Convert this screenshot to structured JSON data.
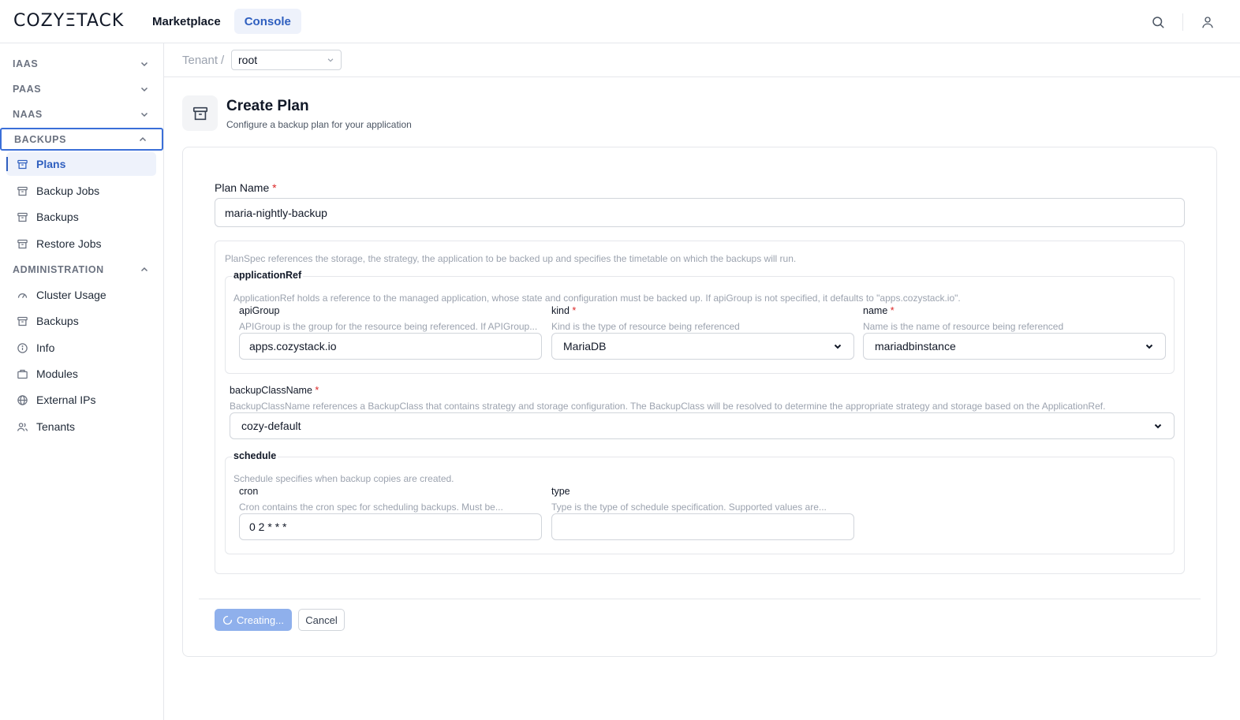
{
  "app": {
    "logo_text": "COZYΞTACK"
  },
  "topnav": {
    "items": [
      "Marketplace",
      "Console"
    ],
    "active": "Console"
  },
  "sidebar": {
    "sections": [
      {
        "label": "IAAS",
        "expanded": false
      },
      {
        "label": "PAAS",
        "expanded": false
      },
      {
        "label": "NAAS",
        "expanded": false
      },
      {
        "label": "BACKUPS",
        "expanded": true,
        "items": [
          {
            "label": "Plans",
            "icon": "archive-icon",
            "active": true
          },
          {
            "label": "Backup Jobs",
            "icon": "archive-icon"
          },
          {
            "label": "Backups",
            "icon": "archive-icon"
          },
          {
            "label": "Restore Jobs",
            "icon": "archive-icon"
          }
        ]
      },
      {
        "label": "ADMINISTRATION",
        "expanded": true,
        "items": [
          {
            "label": "Cluster Usage",
            "icon": "gauge-icon"
          },
          {
            "label": "Backups",
            "icon": "archive-icon"
          },
          {
            "label": "Info",
            "icon": "info-icon"
          },
          {
            "label": "Modules",
            "icon": "box-icon"
          },
          {
            "label": "External IPs",
            "icon": "globe-icon"
          },
          {
            "label": "Tenants",
            "icon": "users-icon"
          }
        ]
      }
    ]
  },
  "breadcrumb": {
    "tenant_label": "Tenant",
    "separator": "/",
    "tenant_value": "root"
  },
  "page": {
    "title": "Create Plan",
    "subtitle": "Configure a backup plan for your application"
  },
  "form": {
    "plan_name": {
      "label": "Plan Name",
      "required": "*",
      "value": "maria-nightly-backup"
    },
    "spec_desc": "PlanSpec references the storage, the strategy, the application to be backed up and specifies the timetable on which the backups will run.",
    "applicationRef": {
      "legend": "applicationRef",
      "desc": "ApplicationRef holds a reference to the managed application, whose state and configuration must be backed up. If apiGroup is not specified, it defaults to \"apps.cozystack.io\".",
      "apiGroup": {
        "label": "apiGroup",
        "desc": "APIGroup is the group for the resource being referenced. If APIGroup...",
        "value": "apps.cozystack.io"
      },
      "kind": {
        "label": "kind",
        "required": "*",
        "desc": "Kind is the type of resource being referenced",
        "value": "MariaDB"
      },
      "name": {
        "label": "name",
        "required": "*",
        "desc": "Name is the name of resource being referenced",
        "value": "mariadbinstance"
      }
    },
    "backupClassName": {
      "label": "backupClassName",
      "required": "*",
      "desc": "BackupClassName references a BackupClass that contains strategy and storage configuration. The BackupClass will be resolved to determine the appropriate strategy and storage based on the ApplicationRef.",
      "value": "cozy-default"
    },
    "schedule": {
      "legend": "schedule",
      "desc": "Schedule specifies when backup copies are created.",
      "cron": {
        "label": "cron",
        "desc": "Cron contains the cron spec for scheduling backups. Must be...",
        "value": "0 2 * * *"
      },
      "type": {
        "label": "type",
        "desc": "Type is the type of schedule specification. Supported values are...",
        "value": ""
      }
    },
    "actions": {
      "create_label": "Creating...",
      "cancel_label": "Cancel"
    }
  },
  "colors": {
    "accent": "#2f5fbf",
    "accent_bg": "#eef2fb",
    "button_disabled": "#8fb0ec",
    "required": "#dc2626"
  }
}
